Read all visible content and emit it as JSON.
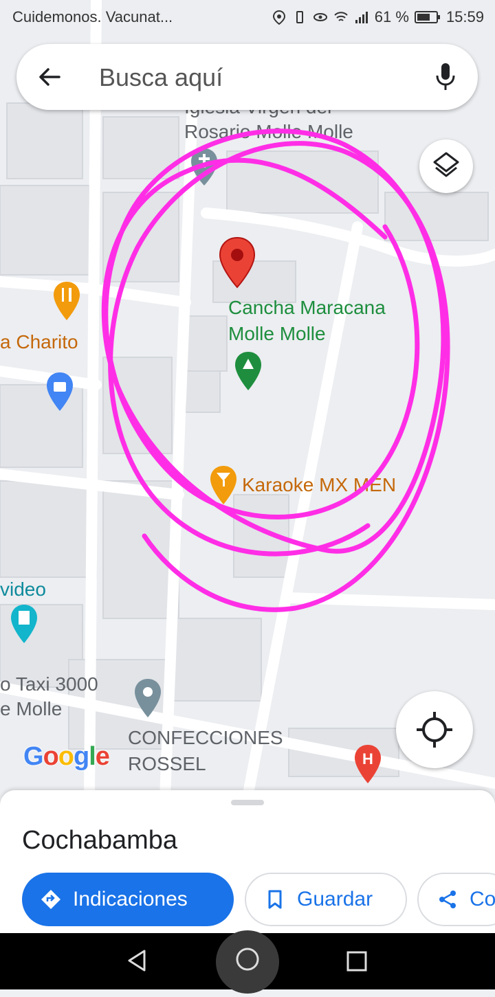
{
  "status_bar": {
    "notification_text": "Cuidemonos. Vacunat...",
    "battery_percent": "61 %",
    "time": "15:59"
  },
  "search": {
    "placeholder": "Busca aquí"
  },
  "map": {
    "labels": {
      "church_line1": "Iglesia Virgen del",
      "church_line2": "Rosario Molle Molle",
      "field_line1": "Cancha Maracana",
      "field_line2": "Molle Molle",
      "charito": "a Charito",
      "karaoke": "Karaoke MX MEN",
      "video": "video",
      "taxi_line1": "o Taxi 3000",
      "taxi_line2": "e Molle",
      "confecciones_line1": "CONFECCIONES",
      "confecciones_line2": "ROSSEL"
    },
    "attribution_letters": [
      {
        "ch": "G",
        "color": "#4285f4"
      },
      {
        "ch": "o",
        "color": "#ea4335"
      },
      {
        "ch": "o",
        "color": "#fbbc05"
      },
      {
        "ch": "g",
        "color": "#4285f4"
      },
      {
        "ch": "l",
        "color": "#34a853"
      },
      {
        "ch": "e",
        "color": "#ea4335"
      }
    ],
    "colors": {
      "annotation": "#ff2ee6",
      "selected_pin": "#ea4335",
      "park_pin": "#1e8e3e",
      "food_pin": "#f29b0c",
      "shop_pin": "#4285f4",
      "hospital_pin": "#ea4335"
    }
  },
  "sheet": {
    "title": "Cochabamba",
    "actions": {
      "directions": "Indicaciones",
      "save": "Guardar",
      "share": "Co"
    }
  }
}
